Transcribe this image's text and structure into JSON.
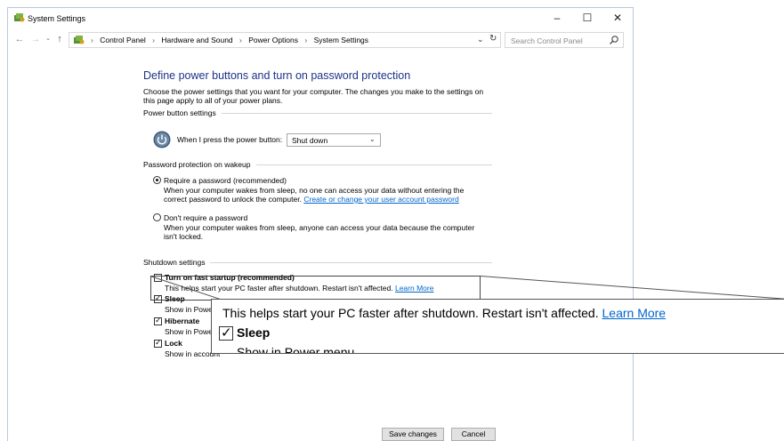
{
  "window": {
    "title": "System Settings",
    "controls": {
      "minimize": "–",
      "maximize": "☐",
      "close": "✕"
    }
  },
  "nav": {
    "back": "←",
    "forward": "→",
    "recent": "⌄",
    "up": "↑",
    "breadcrumb": [
      "Control Panel",
      "Hardware and Sound",
      "Power Options",
      "System Settings"
    ],
    "separator": "›",
    "dropdown": "⌄",
    "refresh": "↻",
    "search_placeholder": "Search Control Panel"
  },
  "page": {
    "heading": "Define power buttons and turn on password protection",
    "intro": "Choose the power settings that you want for your computer. The changes you make to the settings on this page apply to all of your power plans."
  },
  "power_button": {
    "group_label": "Power button settings",
    "label": "When I press the power button:",
    "selected": "Shut down",
    "arrow": "⌄"
  },
  "password": {
    "group_label": "Password protection on wakeup",
    "require_label": "Require a password (recommended)",
    "require_desc": "When your computer wakes from sleep, no one can access your data without entering the correct password to unlock the computer.",
    "require_link": "Create or change your user account password",
    "norequire_label": "Don't require a password",
    "norequire_desc": "When your computer wakes from sleep, anyone can access your data because the computer isn't locked."
  },
  "shutdown": {
    "group_label": "Shutdown settings",
    "fast_startup_label": "Turn on fast startup (recommended)",
    "fast_startup_desc": "This helps start your PC faster after shutdown. Restart isn't affected.",
    "fast_startup_link": "Learn More",
    "sleep_label": "Sleep",
    "sleep_desc": "Show in Power menu.",
    "hibernate_label": "Hibernate",
    "hibernate_desc": "Show in Power menu.",
    "lock_label": "Lock",
    "lock_desc": "Show in account picture menu."
  },
  "zoom": {
    "line1": "This helps start your PC faster after shutdown. Restart isn't affected.",
    "link": "Learn More",
    "sleep_label": "Sleep",
    "sleep_desc": "Show in Power menu."
  },
  "footer": {
    "save": "Save changes",
    "cancel": "Cancel"
  },
  "colors": {
    "heading": "#1e3287",
    "link": "#0066cc",
    "window_border": "#b9c7dc"
  }
}
